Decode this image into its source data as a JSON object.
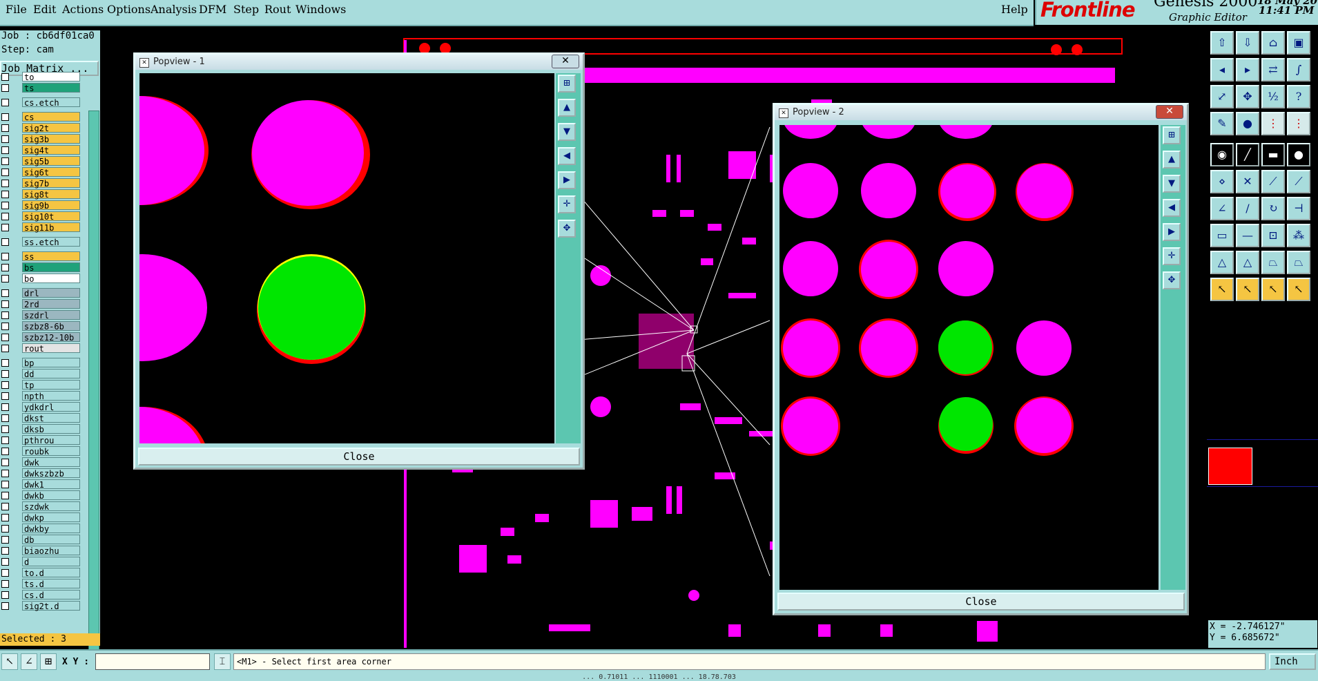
{
  "menubar": {
    "items": [
      "File",
      "Edit",
      "Actions",
      "Options",
      "Analysis",
      "DFM",
      "Step",
      "Rout",
      "Windows"
    ],
    "help": "Help"
  },
  "logo": {
    "brand": "Frontline",
    "product": "Genesis 2000",
    "subtitle": "Graphic Editor",
    "date": "18 May 20",
    "time": "11:41 PM"
  },
  "left": {
    "job": "Job : cb6df01ca0",
    "step": "Step: cam",
    "job_matrix": "Job Matrix ...",
    "layers": [
      {
        "name": "to",
        "color": "#ffffff"
      },
      {
        "name": "ts",
        "color": "#1fa27a"
      },
      {
        "name": "cs.etch",
        "color": "#a8dcdc"
      },
      {
        "name": "cs",
        "color": "#f5c542"
      },
      {
        "name": "sig2t",
        "color": "#f5c542"
      },
      {
        "name": "sig3b",
        "color": "#f5c542"
      },
      {
        "name": "sig4t",
        "color": "#f5c542"
      },
      {
        "name": "sig5b",
        "color": "#f5c542"
      },
      {
        "name": "sig6t",
        "color": "#f5c542"
      },
      {
        "name": "sig7b",
        "color": "#f5c542"
      },
      {
        "name": "sig8t",
        "color": "#f5c542"
      },
      {
        "name": "sig9b",
        "color": "#f5c542"
      },
      {
        "name": "sig10t",
        "color": "#f5c542"
      },
      {
        "name": "sig11b",
        "color": "#f5c542"
      },
      {
        "name": "ss.etch",
        "color": "#a8dcdc"
      },
      {
        "name": "ss",
        "color": "#f5c542"
      },
      {
        "name": "bs",
        "color": "#1fa27a"
      },
      {
        "name": "bo",
        "color": "#ffffff"
      },
      {
        "name": "drl",
        "color": "#9bb7c0"
      },
      {
        "name": "2rd",
        "color": "#9bb7c0"
      },
      {
        "name": "szdrl",
        "color": "#9bb7c0"
      },
      {
        "name": "szbz8-6b",
        "color": "#9bb7c0"
      },
      {
        "name": "szbz12-10b",
        "color": "#9bb7c0"
      },
      {
        "name": "rout",
        "color": "#e4e4e4"
      },
      {
        "name": "bp",
        "color": "#a8dcdc"
      },
      {
        "name": "dd",
        "color": "#a8dcdc"
      },
      {
        "name": "tp",
        "color": "#a8dcdc"
      },
      {
        "name": "npth",
        "color": "#a8dcdc"
      },
      {
        "name": "ydkdrl",
        "color": "#a8dcdc"
      },
      {
        "name": "dkst",
        "color": "#a8dcdc"
      },
      {
        "name": "dksb",
        "color": "#a8dcdc"
      },
      {
        "name": "pthrou",
        "color": "#a8dcdc"
      },
      {
        "name": "roubk",
        "color": "#a8dcdc"
      },
      {
        "name": "dwk",
        "color": "#a8dcdc"
      },
      {
        "name": "dwkszbzb",
        "color": "#a8dcdc"
      },
      {
        "name": "dwk1",
        "color": "#a8dcdc"
      },
      {
        "name": "dwkb",
        "color": "#a8dcdc"
      },
      {
        "name": "szdwk",
        "color": "#a8dcdc"
      },
      {
        "name": "dwkp",
        "color": "#a8dcdc"
      },
      {
        "name": "dwkby",
        "color": "#a8dcdc"
      },
      {
        "name": "db",
        "color": "#a8dcdc"
      },
      {
        "name": "biaozhu",
        "color": "#a8dcdc"
      },
      {
        "name": "d",
        "color": "#a8dcdc"
      },
      {
        "name": "to.d",
        "color": "#a8dcdc"
      },
      {
        "name": "ts.d",
        "color": "#a8dcdc"
      },
      {
        "name": "cs.d",
        "color": "#a8dcdc"
      },
      {
        "name": "sig2t.d",
        "color": "#a8dcdc"
      }
    ],
    "selected": "Selected : 3"
  },
  "popview1": {
    "title": "Popview - 1",
    "close": "Close"
  },
  "popview2": {
    "title": "Popview - 2",
    "close": "Close"
  },
  "bottom": {
    "xy_label": "X Y :",
    "xy_value": "",
    "prompt": "<M1> - Select first area corner",
    "units": "Inch"
  },
  "coords": {
    "x": "X = -2.746127\"",
    "y": "Y = 6.685672\""
  },
  "statusline": "... 0.71011 ... 1110001 ... 18.78.703",
  "colors": {
    "pad": "#ff00ff",
    "outline": "#ff0000",
    "green": "#00e600",
    "panel": "#a8dcdc"
  }
}
